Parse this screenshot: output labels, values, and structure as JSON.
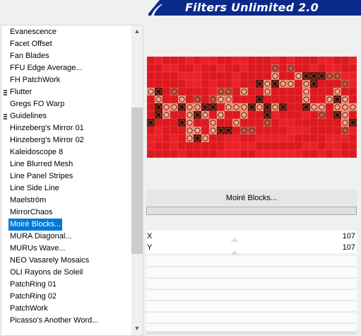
{
  "header": {
    "title": "Filters Unlimited 2.0"
  },
  "filter_list": {
    "items": [
      {
        "label": "Evanescence",
        "marker": false,
        "selected": false
      },
      {
        "label": "Facet Offset",
        "marker": false,
        "selected": false
      },
      {
        "label": "Fan Blades",
        "marker": false,
        "selected": false
      },
      {
        "label": "FFU Edge Average...",
        "marker": false,
        "selected": false
      },
      {
        "label": "FH PatchWork",
        "marker": false,
        "selected": false
      },
      {
        "label": "Flutter",
        "marker": true,
        "selected": false
      },
      {
        "label": "Gregs FO Warp",
        "marker": false,
        "selected": false
      },
      {
        "label": "Guidelines",
        "marker": true,
        "selected": false
      },
      {
        "label": "Hinzeberg's Mirror 01",
        "marker": false,
        "selected": false
      },
      {
        "label": "Hinzeberg's Mirror 02",
        "marker": false,
        "selected": false
      },
      {
        "label": "Kaleidoscope 8",
        "marker": false,
        "selected": false
      },
      {
        "label": "Line Blurred Mesh",
        "marker": false,
        "selected": false
      },
      {
        "label": "Line Panel Stripes",
        "marker": false,
        "selected": false
      },
      {
        "label": "Line Side Line",
        "marker": false,
        "selected": false
      },
      {
        "label": "Maelström",
        "marker": false,
        "selected": false
      },
      {
        "label": "MirrorChaos",
        "marker": false,
        "selected": false
      },
      {
        "label": "Moiré Blocks...",
        "marker": false,
        "selected": true
      },
      {
        "label": "MURA Diagonal...",
        "marker": false,
        "selected": false
      },
      {
        "label": "MURUs Wave...",
        "marker": false,
        "selected": false
      },
      {
        "label": "NEO Vasarely Mosaics",
        "marker": false,
        "selected": false
      },
      {
        "label": "OLI Rayons de Soleil",
        "marker": false,
        "selected": false
      },
      {
        "label": "PatchRing 01",
        "marker": false,
        "selected": false
      },
      {
        "label": "PatchRing 02",
        "marker": false,
        "selected": false
      },
      {
        "label": "PatchWork",
        "marker": false,
        "selected": false
      },
      {
        "label": "Picasso's Another Word...",
        "marker": false,
        "selected": false
      }
    ],
    "scroll_up_icon": "arrow-up-icon",
    "scroll_down_icon": "arrow-down-icon"
  },
  "preview": {
    "description_colors": {
      "base": "#e31c24",
      "light": "#f6b49c",
      "dark": "#2a0a08"
    }
  },
  "filter_panel": {
    "filter_name": "Moiré Blocks...",
    "params": [
      {
        "label": "X",
        "value": "107"
      },
      {
        "label": "Y",
        "value": "107"
      }
    ]
  },
  "colors": {
    "banner": "#0a2a8a",
    "selection": "#0078d7",
    "preview_red": "#e31c24"
  }
}
